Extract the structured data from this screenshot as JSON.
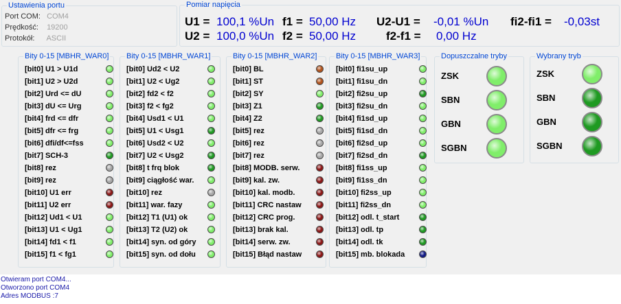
{
  "colors": {
    "led_light": "#80ee6a",
    "led_dark": "#1f9a22",
    "led_red": "#8a1616",
    "led_orange": "#b0521c",
    "led_gray": "#a8a8a8",
    "led_blue": "#121b86",
    "group_title": "#0046d5",
    "value_blue": "#0000d0",
    "log_text": "#1818a8"
  },
  "port": {
    "title": "Ustawienia portu",
    "rows": [
      {
        "label": "Port COM:",
        "value": "COM4"
      },
      {
        "label": "Prędkość:",
        "value": "19200"
      },
      {
        "label": "Protokół:",
        "value": "ASCII"
      }
    ]
  },
  "pomiar": {
    "title": "Pomiar napięcia",
    "row1": {
      "u_label": "U1 =",
      "u_val": "100,1 %Un",
      "f_label": "f1 =",
      "f_val": "50,00 Hz",
      "d_label": "U2-U1 =",
      "d_val": "-0,01 %Un",
      "fd_label": "fi2-fi1 =",
      "fd_val": "-0,03st"
    },
    "row2": {
      "u_label": "U2 =",
      "u_val": "100,0 %Un",
      "f_label": "f2 =",
      "f_val": "50,00 Hz",
      "d_label": "f2-f1 =",
      "d_val": "0,00 Hz"
    }
  },
  "bit_groups": [
    {
      "title": "Bity 0-15 [MBHR_WAR0]",
      "items": [
        {
          "label": "[bit0] U1 > U1d",
          "state": "light"
        },
        {
          "label": "[bit1] U2 > U2d",
          "state": "light"
        },
        {
          "label": "[bit2] Urd <= dU",
          "state": "light"
        },
        {
          "label": "[bit3] dU <= Urg",
          "state": "light"
        },
        {
          "label": "[bit4] frd <= dfr",
          "state": "light"
        },
        {
          "label": "[bit5] dfr <= frg",
          "state": "light"
        },
        {
          "label": "[bit6] dfi/df<=fss",
          "state": "light"
        },
        {
          "label": "[bit7] SCH-3",
          "state": "dark"
        },
        {
          "label": "[bit8] rez",
          "state": "gray"
        },
        {
          "label": "[bit9] rez",
          "state": "gray"
        },
        {
          "label": "[bit10] U1 err",
          "state": "red"
        },
        {
          "label": "[bit11] U2 err",
          "state": "red"
        },
        {
          "label": "[bit12] Ud1 < U1",
          "state": "light"
        },
        {
          "label": "[bit13] U1 < Ug1",
          "state": "light"
        },
        {
          "label": "[bit14] fd1 < f1",
          "state": "light"
        },
        {
          "label": "[bit15] f1 < fg1",
          "state": "light"
        }
      ]
    },
    {
      "title": "Bity 0-15 [MBHR_WAR1]",
      "items": [
        {
          "label": "[bit0] Ud2 < U2",
          "state": "light"
        },
        {
          "label": "[bit1] U2 < Ug2",
          "state": "light"
        },
        {
          "label": "[bit2] fd2 < f2",
          "state": "light"
        },
        {
          "label": "[bit3] f2 < fg2",
          "state": "light"
        },
        {
          "label": "[bit4] Usd1 < U1",
          "state": "light"
        },
        {
          "label": "[bit5] U1 < Usg1",
          "state": "dark"
        },
        {
          "label": "[bit6] Usd2 < U2",
          "state": "light"
        },
        {
          "label": "[bit7] U2 < Usg2",
          "state": "dark"
        },
        {
          "label": "[bit8] t frq blok",
          "state": "dark"
        },
        {
          "label": "[bit9] ciągłość war.",
          "state": "light"
        },
        {
          "label": "[bit10] rez",
          "state": "gray"
        },
        {
          "label": "[bit11] war. fazy",
          "state": "light"
        },
        {
          "label": "[bit12] T1 (U1) ok",
          "state": "light"
        },
        {
          "label": "[bit13] T2 (U2) ok",
          "state": "light"
        },
        {
          "label": "[bit14] syn. od góry",
          "state": "light"
        },
        {
          "label": "[bit15] syn. od dołu",
          "state": "light"
        }
      ]
    },
    {
      "title": "Bity 0-15 [MBHR_WAR2]",
      "items": [
        {
          "label": "[bit0] BL",
          "state": "orange"
        },
        {
          "label": "[bit1] ST",
          "state": "orange"
        },
        {
          "label": "[bit2] SY",
          "state": "light"
        },
        {
          "label": "[bit3] Z1",
          "state": "dark"
        },
        {
          "label": "[bit4] Z2",
          "state": "dark"
        },
        {
          "label": "[bit5] rez",
          "state": "gray"
        },
        {
          "label": "[bit6] rez",
          "state": "gray"
        },
        {
          "label": "[bit7] rez",
          "state": "gray"
        },
        {
          "label": "[bit8] MODB. serw.",
          "state": "red"
        },
        {
          "label": "[bit9] kal. zw.",
          "state": "red"
        },
        {
          "label": "[bit10] kal. modb.",
          "state": "red"
        },
        {
          "label": "[bit11] CRC nastaw",
          "state": "red"
        },
        {
          "label": "[bit12] CRC prog.",
          "state": "red"
        },
        {
          "label": "[bit13] brak kal.",
          "state": "red"
        },
        {
          "label": "[bit14] serw. zw.",
          "state": "red"
        },
        {
          "label": "[bit15] Błąd nastaw",
          "state": "red"
        }
      ]
    },
    {
      "title": "Bity 0-15 [MBHR_WAR3]",
      "items": [
        {
          "label": "[bit0] fi1su_up",
          "state": "light"
        },
        {
          "label": "[bit1] fi1su_dn",
          "state": "light"
        },
        {
          "label": "[bit2] fi2su_up",
          "state": "dark"
        },
        {
          "label": "[bit3] fi2su_dn",
          "state": "light"
        },
        {
          "label": "[bit4] fi1sd_up",
          "state": "light"
        },
        {
          "label": "[bit5] fi1sd_dn",
          "state": "light"
        },
        {
          "label": "[bit6] fi2sd_up",
          "state": "light"
        },
        {
          "label": "[bit7] fi2sd_dn",
          "state": "dark"
        },
        {
          "label": "[bit8] fi1ss_up",
          "state": "light"
        },
        {
          "label": "[bit9] fi1ss_dn",
          "state": "light"
        },
        {
          "label": "[bit10] fi2ss_up",
          "state": "light"
        },
        {
          "label": "[bit11] fi2ss_dn",
          "state": "light"
        },
        {
          "label": "[bit12] odl. t_start",
          "state": "dark"
        },
        {
          "label": "[bit13] odl. tp",
          "state": "dark"
        },
        {
          "label": "[bit14] odl. tk",
          "state": "dark"
        },
        {
          "label": "[bit15] mb. blokada",
          "state": "blue"
        }
      ]
    }
  ],
  "tryby_dopuszczalne": {
    "title": "Dopuszczalne tryby",
    "items": [
      {
        "label": "ZSK",
        "state": "light"
      },
      {
        "label": "SBN",
        "state": "light"
      },
      {
        "label": "GBN",
        "state": "light"
      },
      {
        "label": "SGBN",
        "state": "light"
      }
    ]
  },
  "tryb_wybrany": {
    "title": "Wybrany tryb",
    "items": [
      {
        "label": "ZSK",
        "state": "light"
      },
      {
        "label": "SBN",
        "state": "dark"
      },
      {
        "label": "GBN",
        "state": "dark"
      },
      {
        "label": "SGBN",
        "state": "dark"
      }
    ]
  },
  "log": [
    "Otwieram port COM4...",
    "Otworzono port COM4",
    "Adres MODBUS :7"
  ]
}
